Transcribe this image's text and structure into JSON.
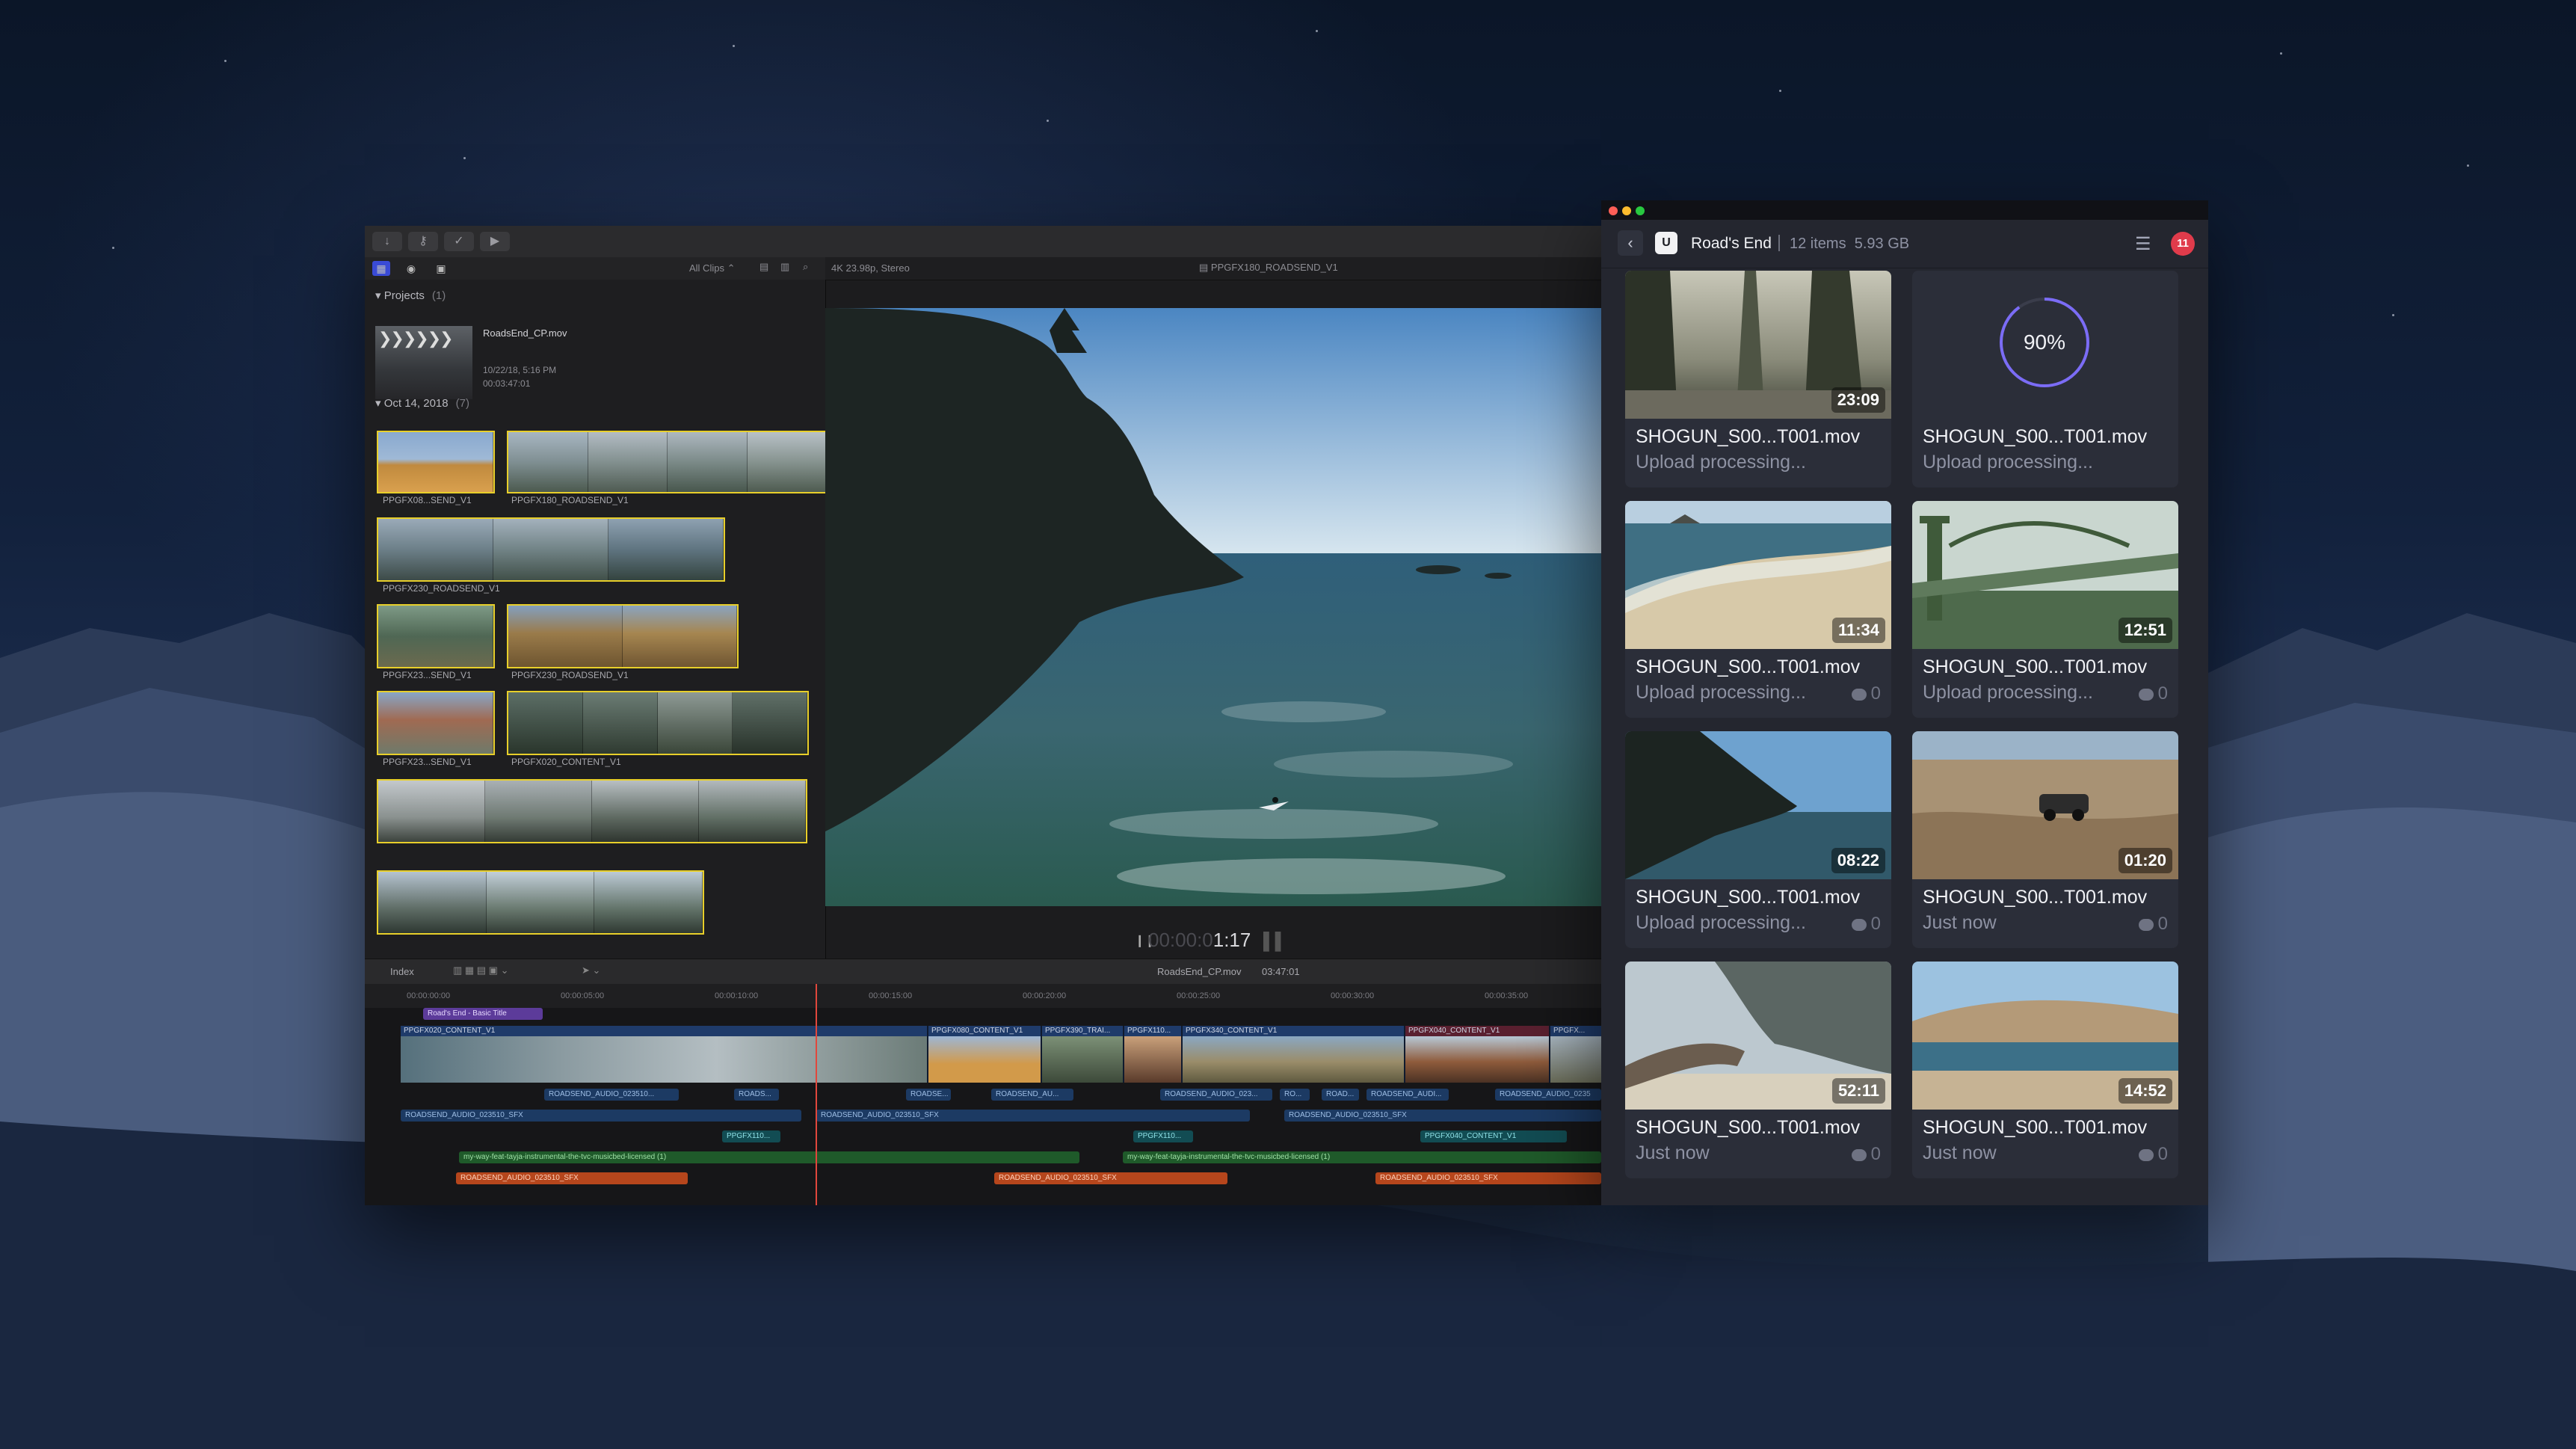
{
  "colors": {
    "accent": "#7b6cf6",
    "badge": "#e03b4b",
    "clip_outline": "#e8cf2a",
    "playhead": "#e0473c"
  },
  "fcp": {
    "toolbar_icons": [
      "download-icon",
      "key-icon",
      "check-icon",
      "share-icon"
    ],
    "all_clips_label": "All Clips ⌃",
    "format_info": "4K 23.98p, Stereo",
    "viewer_title": "PPGFX180_ROADSEND_V1",
    "projects_header": "Projects",
    "projects_count": "(1)",
    "project_name": "RoadsEnd_CP.mov",
    "project_date": "10/22/18, 5:16 PM",
    "project_duration": "00:03:47:01",
    "event_header": "Oct 14, 2018",
    "event_count": "(7)",
    "clip_labels": [
      "PPGFX08...SEND_V1",
      "PPGFX180_ROADSEND_V1",
      "PPGFX230_ROADSEND_V1",
      "PPGFX23...SEND_V1",
      "PPGFX230_ROADSEND_V1",
      "PPGFX23...SEND_V1",
      "PPGFX020_CONTENT_V1"
    ],
    "timecode_dim": "00:00:0",
    "timecode": "1:17",
    "timeline_index": "Index",
    "timeline_project": "RoadsEnd_CP.mov",
    "timeline_duration": "03:47:01",
    "ruler": [
      "00:00:00:00",
      "00:00:05:00",
      "00:00:10:00",
      "00:00:15:00",
      "00:00:20:00",
      "00:00:25:00",
      "00:00:30:00",
      "00:00:35:00"
    ],
    "title_clip": "Road's End - Basic Title",
    "video_clips": [
      "PPGFX020_CONTENT_V1",
      "PPGFX080_CONTENT_V1",
      "PPGFX390_TRAI...",
      "PPGFX110...",
      "PPGFX340_CONTENT_V1",
      "PPGFX040_CONTENT_V1",
      "PPGFX..."
    ],
    "audio_row1": [
      "ROADSEND_AUDIO_023510...",
      "ROADS...",
      "ROADSE...",
      "ROADSEND_AU...",
      "ROADSEND_AUDIO_023...",
      "RO...",
      "ROAD...",
      "ROADSEND_AUDI...",
      "ROADSEND_AUDIO_0235"
    ],
    "audio_row2": [
      "ROADSEND_AUDIO_023510_SFX",
      "ROADSEND_AUDIO_023510_SFX",
      "ROADSEND_AUDIO_023510_SFX"
    ],
    "teal_row": [
      "PPGFX110...",
      "PPGFX110...",
      "PPGFX040_CONTENT_V1"
    ],
    "music": [
      "my-way-feat-tayja-instrumental-the-tvc-musicbed-licensed (1)",
      "my-way-feat-tayja-instrumental-the-tvc-musicbed-licensed (1)"
    ],
    "orange_row": [
      "ROADSEND_AUDIO_023510_SFX",
      "ROADSEND_AUDIO_023510_SFX",
      "ROADSEND_AUDIO_023510_SFX"
    ]
  },
  "frameio": {
    "back_icon": "chevron-left-icon",
    "project_initial": "U",
    "project_title": "Road's End",
    "project_items": "12 items",
    "project_size": "5.93 GB",
    "notifications": "11",
    "assets": [
      {
        "name": "SHOGUN_S00...T001.mov",
        "status": "Upload processing...",
        "duration": "23:09",
        "comments": null,
        "scene": "forest"
      },
      {
        "name": "SHOGUN_S00...T001.mov",
        "status": "Upload processing...",
        "duration": null,
        "progress": "90%",
        "progress_value": 0.9,
        "comments": null,
        "scene": "uploading"
      },
      {
        "name": "SHOGUN_S00...T001.mov",
        "status": "Upload processing...",
        "duration": "11:34",
        "comments": "0",
        "scene": "beach"
      },
      {
        "name": "SHOGUN_S00...T001.mov",
        "status": "Upload processing...",
        "duration": "12:51",
        "comments": "0",
        "scene": "bridge"
      },
      {
        "name": "SHOGUN_S00...T001.mov",
        "status": "Upload processing...",
        "duration": "08:22",
        "comments": "0",
        "scene": "cliff"
      },
      {
        "name": "SHOGUN_S00...T001.mov",
        "status": "Just now",
        "duration": "01:20",
        "comments": "0",
        "scene": "sand"
      },
      {
        "name": "SHOGUN_S00...T001.mov",
        "status": "Just now",
        "duration": "52:11",
        "comments": "0",
        "scene": "driftwood"
      },
      {
        "name": "SHOGUN_S00...T001.mov",
        "status": "Just now",
        "duration": "14:52",
        "comments": "0",
        "scene": "coast"
      }
    ]
  }
}
